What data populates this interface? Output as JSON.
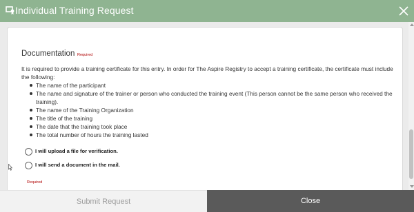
{
  "header": {
    "title": "Individual Training Request",
    "icon": "certificate-icon",
    "close_icon": "close-icon"
  },
  "documentation": {
    "heading": "Documentation",
    "required_tag": "Required",
    "intro": "It is required to provide a training certificate for this entry. In order for The Aspire Registry to accept a training certificate, the certificate must include the following:",
    "items": [
      "The name of the participant",
      "The name and signature of the trainer or person who conducted the training event (This person cannot be the same person who received the training).",
      "The name of the Training Organization",
      "The title of the training",
      "The date that the training took place",
      "The total number of hours the training lasted"
    ],
    "options": [
      "I will upload a file for verification.",
      "I will send a document in the mail."
    ],
    "required_bottom": "Required"
  },
  "footer": {
    "submit_label": "Submit Request",
    "close_label": "Close"
  },
  "colors": {
    "header_bg": "#8fb491",
    "required_red": "#b00000",
    "close_bg": "#5a5a5a"
  }
}
